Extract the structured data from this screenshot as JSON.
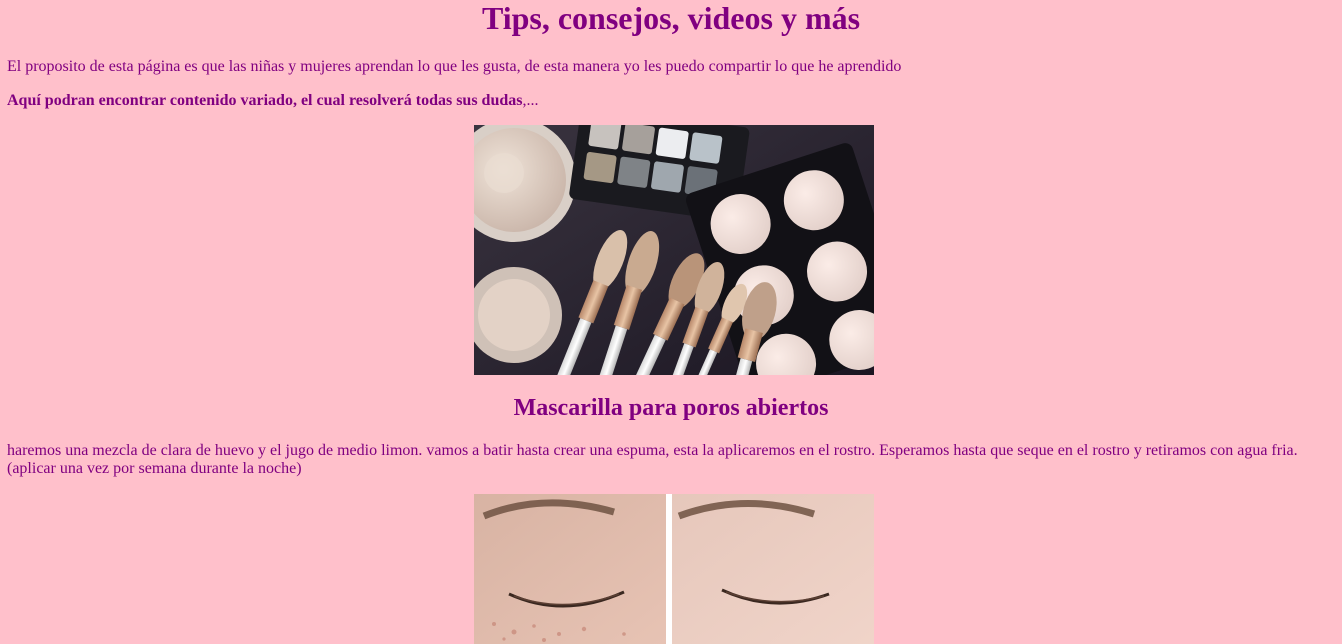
{
  "page": {
    "title": "Tips, consejos, videos y más",
    "intro": "El proposito de esta página es que las niñas y mujeres aprendan lo que les gusta, de esta manera yo les puedo compartir lo que he aprendido",
    "highlight_bold": "Aquí podran encontrar contenido variado, el cual resolverá todas sus dudas",
    "highlight_tail": ",..."
  },
  "images": {
    "makeup": "makeup-products-photo",
    "face": "before-after-face-photo"
  },
  "section": {
    "heading": "Mascarilla para poros abiertos",
    "body": "haremos una mezcla de clara de huevo y el jugo de medio limon. vamos a batir hasta crear una espuma, esta la aplicaremos en el rostro. Esperamos hasta que seque en el rostro y retiramos con agua fria. (aplicar una vez por semana durante la noche)"
  },
  "colors": {
    "background": "#ffc0cb",
    "text": "#800080"
  }
}
